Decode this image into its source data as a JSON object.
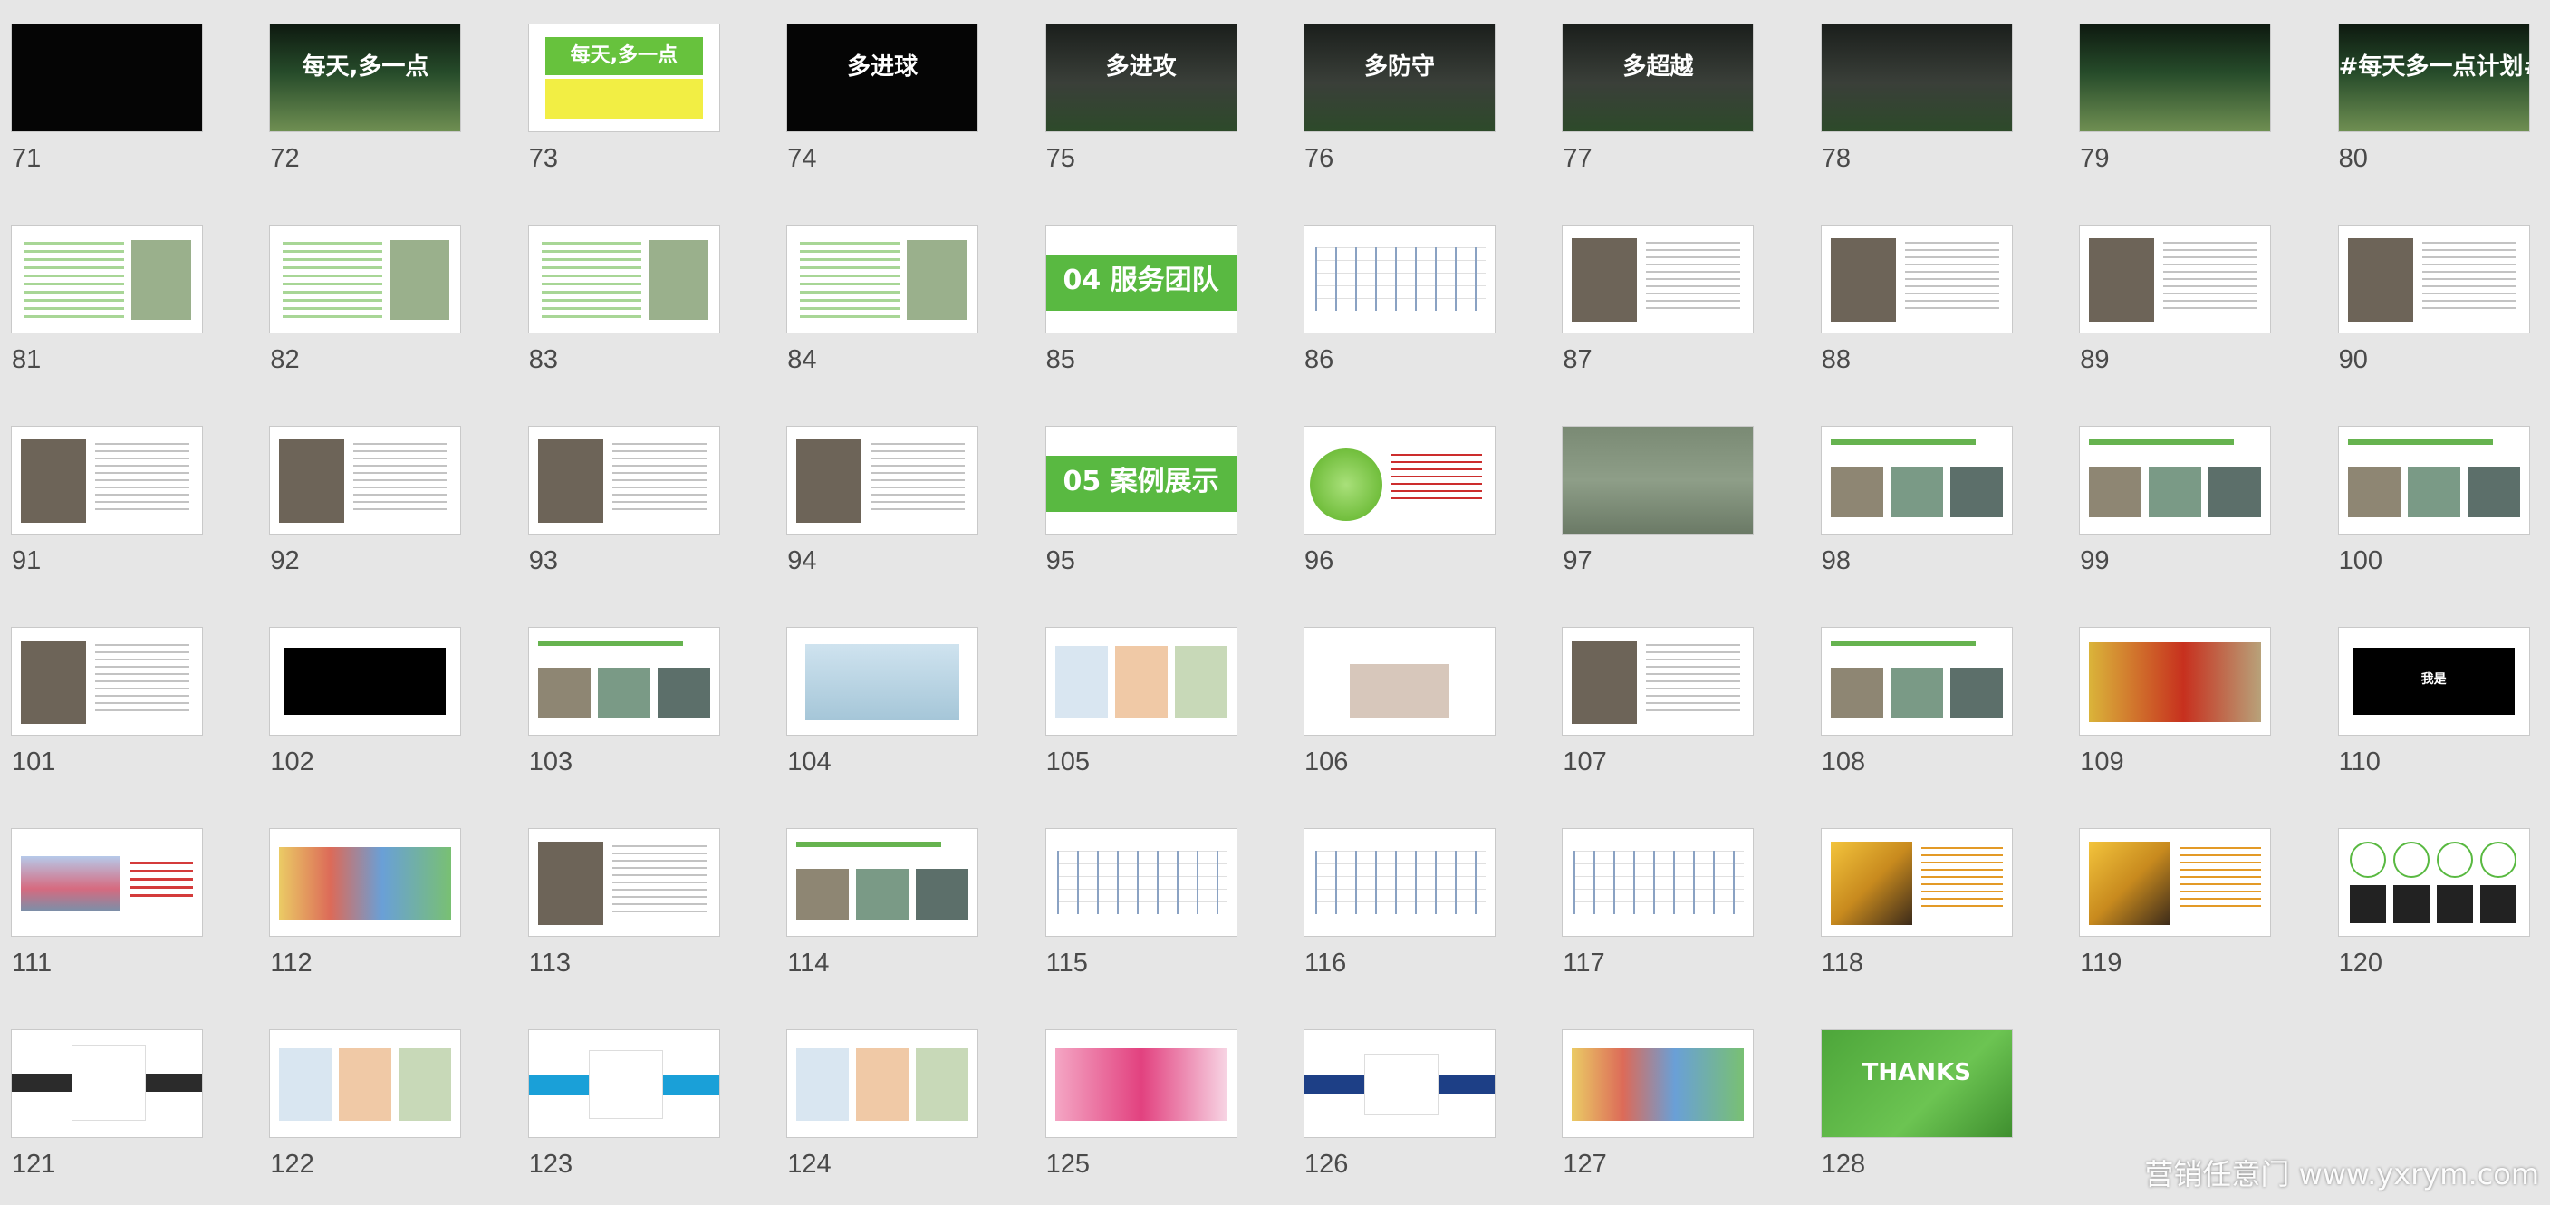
{
  "slides": [
    {
      "num": "71",
      "theme": "th-black",
      "text": ""
    },
    {
      "num": "72",
      "theme": "th-stadium",
      "text": "每天,多一点"
    },
    {
      "num": "73",
      "theme": "th-yellowgreen",
      "text": "每天,多一点"
    },
    {
      "num": "74",
      "theme": "th-black",
      "text": "多进球"
    },
    {
      "num": "75",
      "theme": "th-dark",
      "text": "多进攻"
    },
    {
      "num": "76",
      "theme": "th-dark",
      "text": "多防守"
    },
    {
      "num": "77",
      "theme": "th-dark",
      "text": "多超越"
    },
    {
      "num": "78",
      "theme": "th-dark",
      "text": ""
    },
    {
      "num": "79",
      "theme": "th-stadium",
      "text": ""
    },
    {
      "num": "80",
      "theme": "th-stadium",
      "text": "#每天多一点计划#"
    },
    {
      "num": "81",
      "theme": "th-white",
      "text": ""
    },
    {
      "num": "82",
      "theme": "th-white",
      "text": ""
    },
    {
      "num": "83",
      "theme": "th-white",
      "text": ""
    },
    {
      "num": "84",
      "theme": "th-white",
      "text": ""
    },
    {
      "num": "85",
      "theme": "th-greenband",
      "text": "04 服务团队"
    },
    {
      "num": "86",
      "theme": "th-diagram",
      "text": ""
    },
    {
      "num": "87",
      "theme": "th-photo",
      "text": ""
    },
    {
      "num": "88",
      "theme": "th-photo",
      "text": ""
    },
    {
      "num": "89",
      "theme": "th-photo",
      "text": ""
    },
    {
      "num": "90",
      "theme": "th-photo",
      "text": ""
    },
    {
      "num": "91",
      "theme": "th-photo",
      "text": ""
    },
    {
      "num": "92",
      "theme": "th-photo",
      "text": ""
    },
    {
      "num": "93",
      "theme": "th-photo",
      "text": ""
    },
    {
      "num": "94",
      "theme": "th-photo",
      "text": ""
    },
    {
      "num": "95",
      "theme": "th-greenband",
      "text": "05 案例展示"
    },
    {
      "num": "96",
      "theme": "th-green-lime",
      "text": ""
    },
    {
      "num": "97",
      "theme": "th-film",
      "text": ""
    },
    {
      "num": "98",
      "theme": "th-collage",
      "text": ""
    },
    {
      "num": "99",
      "theme": "th-collage",
      "text": ""
    },
    {
      "num": "100",
      "theme": "th-collage",
      "text": ""
    },
    {
      "num": "101",
      "theme": "th-photo",
      "text": ""
    },
    {
      "num": "102",
      "theme": "th-blackcenter",
      "text": ""
    },
    {
      "num": "103",
      "theme": "th-collage",
      "text": ""
    },
    {
      "num": "104",
      "theme": "th-blue",
      "text": ""
    },
    {
      "num": "105",
      "theme": "th-grid",
      "text": ""
    },
    {
      "num": "106",
      "theme": "th-pale",
      "text": ""
    },
    {
      "num": "107",
      "theme": "th-photo",
      "text": ""
    },
    {
      "num": "108",
      "theme": "th-collage",
      "text": ""
    },
    {
      "num": "109",
      "theme": "th-yellowpic",
      "text": ""
    },
    {
      "num": "110",
      "theme": "th-blackcenter",
      "text": "我是"
    },
    {
      "num": "111",
      "theme": "th-city",
      "text": ""
    },
    {
      "num": "112",
      "theme": "th-bright",
      "text": ""
    },
    {
      "num": "113",
      "theme": "th-photo",
      "text": ""
    },
    {
      "num": "114",
      "theme": "th-collage",
      "text": ""
    },
    {
      "num": "115",
      "theme": "th-diagram",
      "text": ""
    },
    {
      "num": "116",
      "theme": "th-diagram",
      "text": ""
    },
    {
      "num": "117",
      "theme": "th-diagram",
      "text": ""
    },
    {
      "num": "118",
      "theme": "th-ofo",
      "text": ""
    },
    {
      "num": "119",
      "theme": "th-ofo",
      "text": ""
    },
    {
      "num": "120",
      "theme": "th-circles",
      "text": ""
    },
    {
      "num": "121",
      "theme": "th-olay",
      "text": ""
    },
    {
      "num": "122",
      "theme": "th-grid",
      "text": ""
    },
    {
      "num": "123",
      "theme": "th-cyan",
      "text": ""
    },
    {
      "num": "124",
      "theme": "th-grid",
      "text": ""
    },
    {
      "num": "125",
      "theme": "th-pink",
      "text": ""
    },
    {
      "num": "126",
      "theme": "th-navy",
      "text": ""
    },
    {
      "num": "127",
      "theme": "th-bright",
      "text": ""
    },
    {
      "num": "128",
      "theme": "th-greenfull",
      "text": "THANKS"
    }
  ],
  "watermark": "营销任意门 www.yxrym.com"
}
